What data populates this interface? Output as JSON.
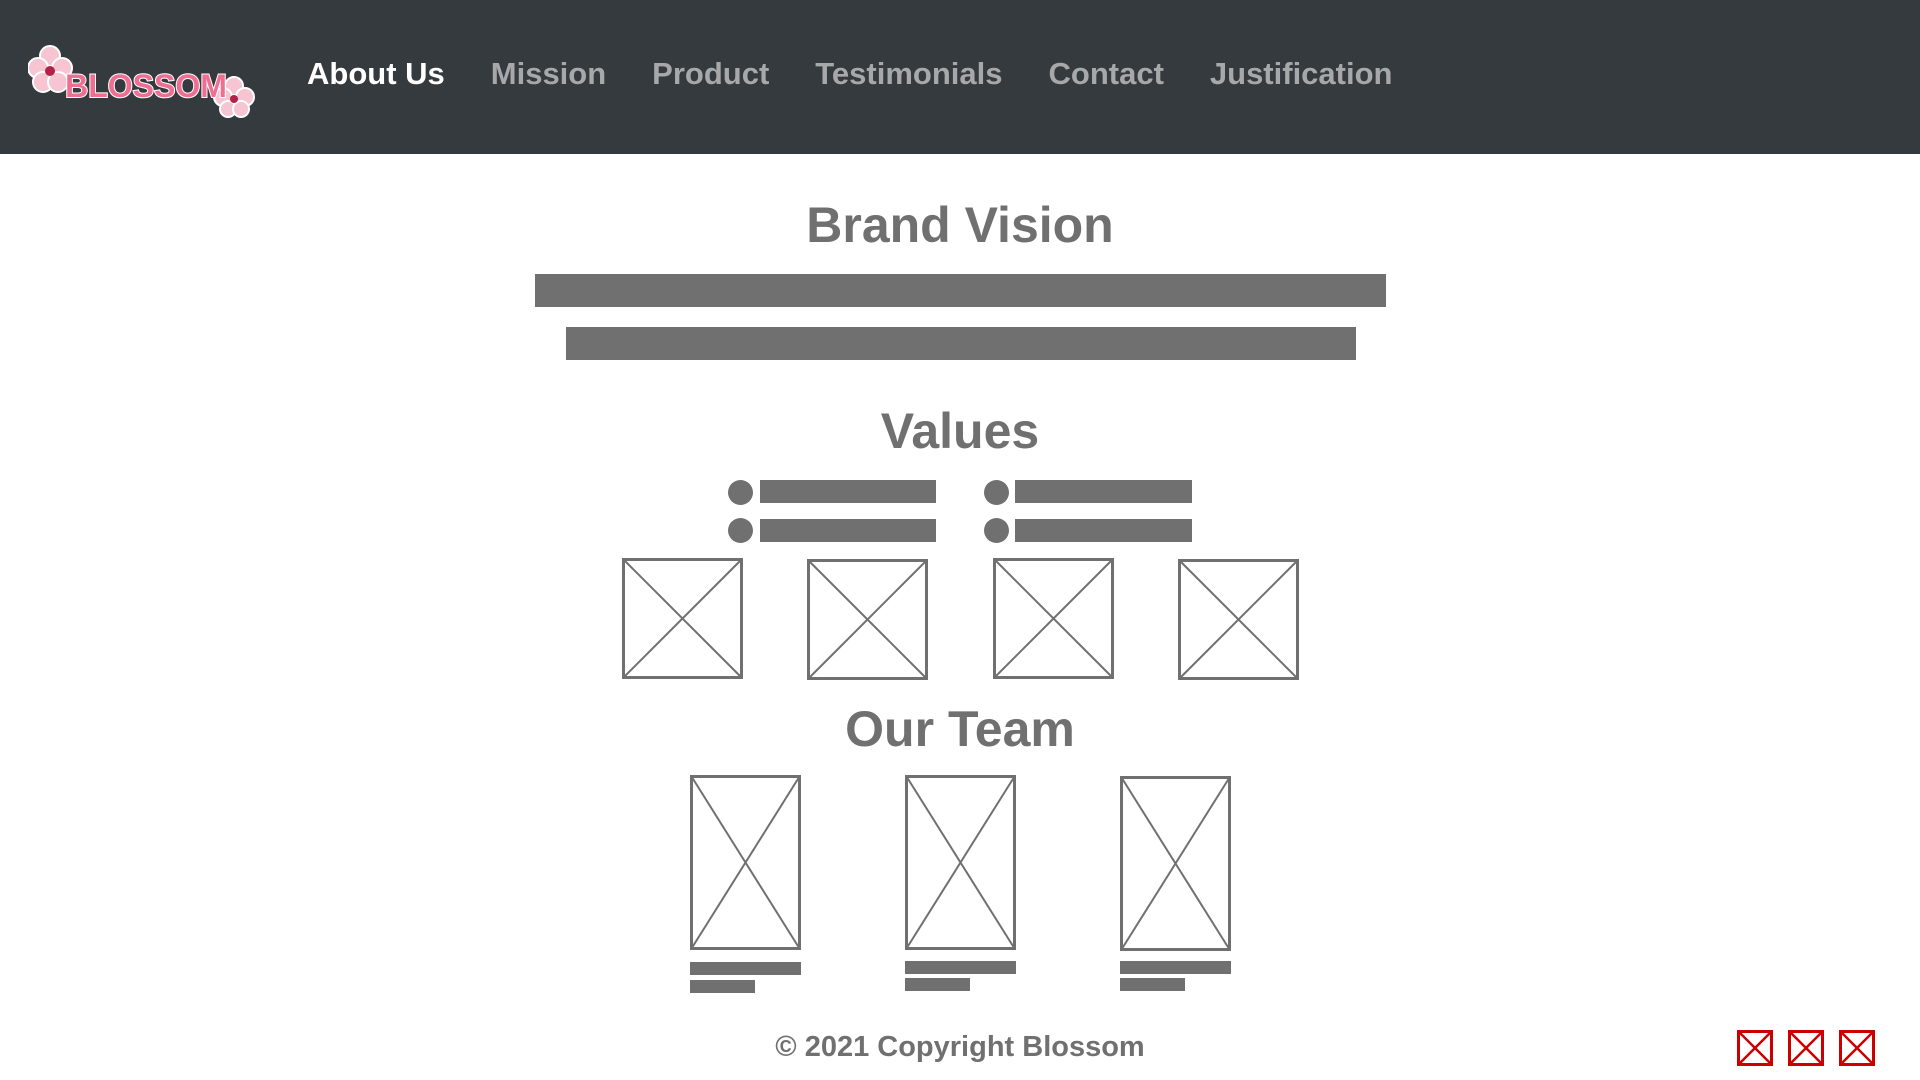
{
  "nav": {
    "logo_text": "BLOSSOM",
    "links": [
      {
        "label": "About Us",
        "active": true
      },
      {
        "label": "Mission",
        "active": false
      },
      {
        "label": "Product",
        "active": false
      },
      {
        "label": "Testimonials",
        "active": false
      },
      {
        "label": "Contact",
        "active": false
      },
      {
        "label": "Justification",
        "active": false
      }
    ]
  },
  "sections": {
    "brand_vision": {
      "title": "Brand Vision"
    },
    "values": {
      "title": "Values"
    },
    "team": {
      "title": "Our Team"
    }
  },
  "footer": {
    "copyright": "© 2021 Copyright Blossom",
    "social_icons": [
      "social-icon-placeholder",
      "social-icon-placeholder",
      "social-icon-placeholder"
    ]
  },
  "colors": {
    "navbar_bg": "#353a3e",
    "nav_text": "#a7a8aa",
    "nav_active": "#ffffff",
    "placeholder_gray": "#707070",
    "logo_pink": "#ef6f93",
    "social_red": "#cc0000"
  }
}
